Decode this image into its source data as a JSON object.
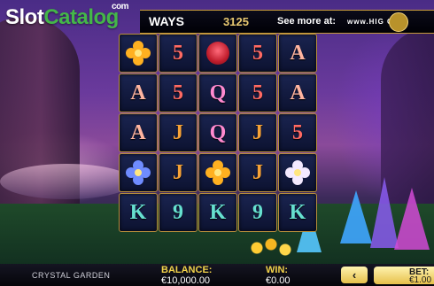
{
  "watermark": {
    "brand_first": "Slot",
    "brand_second": "Catalog",
    "suffix": "com"
  },
  "top_bar": {
    "ways_label": "WAYS",
    "ways_value": "3125",
    "see_more_label": "See more at:",
    "site_text": "www.HIG  GAM"
  },
  "reels": [
    [
      "orange-flower",
      "5",
      "red-rose",
      "5",
      "A"
    ],
    [
      "A",
      "5",
      "Q",
      "5",
      "A"
    ],
    [
      "A",
      "J",
      "Q",
      "J",
      "5"
    ],
    [
      "blue-flower",
      "J",
      "orange-flower",
      "J",
      "white-lily"
    ],
    [
      "K",
      "9",
      "K",
      "9",
      "K"
    ]
  ],
  "symbol_colors": {
    "A": "#ffb5a0",
    "5": "#ff6a63",
    "Q": "#ff8ad0",
    "J": "#f6a237",
    "K": "#66e0d0",
    "9": "#66e0d0"
  },
  "bottom_bar": {
    "game_name": "CRYSTAL GARDEN",
    "balance_label": "BALANCE:",
    "balance_value": "€10,000.00",
    "win_label": "WIN:",
    "win_value": "€0.00",
    "prev_bet_icon": "‹",
    "bet_label": "BET:",
    "bet_value": "€1.00"
  }
}
